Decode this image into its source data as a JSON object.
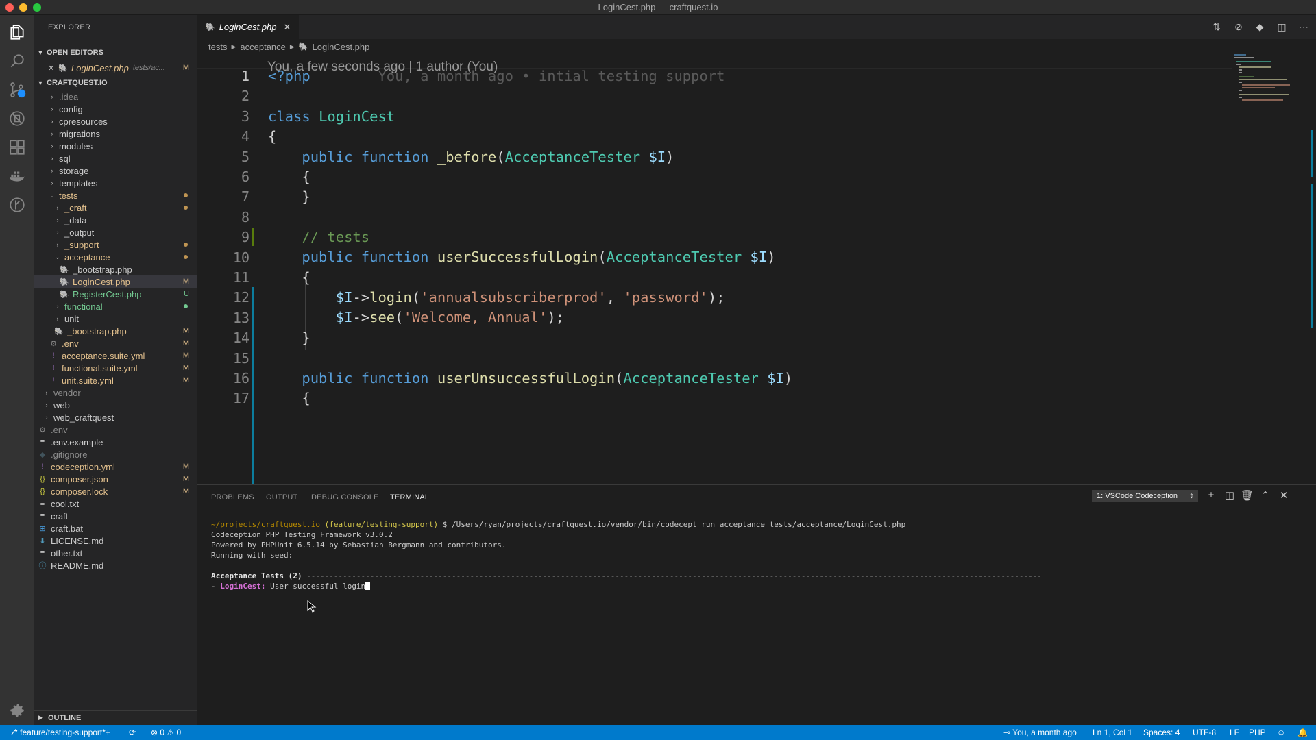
{
  "window": {
    "title": "LoginCest.php — craftquest.io"
  },
  "sidebar": {
    "title": "EXPLORER",
    "open_editors_label": "OPEN EDITORS",
    "open_editor": {
      "name": "LoginCest.php",
      "path": "tests/ac...",
      "status": "M",
      "close": "✕"
    },
    "project_label": "CRAFTQUEST.IO",
    "tree": [
      {
        "label": ".idea",
        "chev": "›"
      },
      {
        "label": "config",
        "chev": "›"
      },
      {
        "label": "cpresources",
        "chev": "›"
      },
      {
        "label": "migrations",
        "chev": "›"
      },
      {
        "label": "modules",
        "chev": "›"
      },
      {
        "label": "sql",
        "chev": "›"
      },
      {
        "label": "storage",
        "chev": "›"
      },
      {
        "label": "templates",
        "chev": "›"
      },
      {
        "label": "tests",
        "chev": "⌄"
      },
      {
        "label": "_craft",
        "chev": "›"
      },
      {
        "label": "_data",
        "chev": "›"
      },
      {
        "label": "_output",
        "chev": "›"
      },
      {
        "label": "_support",
        "chev": "›"
      },
      {
        "label": "acceptance",
        "chev": "⌄"
      },
      {
        "label": "_bootstrap.php",
        "icon": "🐘"
      },
      {
        "label": "LoginCest.php",
        "icon": "🐘",
        "status": "M"
      },
      {
        "label": "RegisterCest.php",
        "icon": "🐘",
        "status": "U"
      },
      {
        "label": "functional",
        "chev": "›"
      },
      {
        "label": "unit",
        "chev": "›"
      },
      {
        "label": "_bootstrap.php",
        "icon": "🐘",
        "status": "M"
      },
      {
        "label": ".env",
        "icon": "⚙",
        "status": "M"
      },
      {
        "label": "acceptance.suite.yml",
        "icon": "!",
        "status": "M"
      },
      {
        "label": "functional.suite.yml",
        "icon": "!",
        "status": "M"
      },
      {
        "label": "unit.suite.yml",
        "icon": "!",
        "status": "M"
      },
      {
        "label": "vendor",
        "chev": "›"
      },
      {
        "label": "web",
        "chev": "›"
      },
      {
        "label": "web_craftquest",
        "chev": "›"
      },
      {
        "label": ".env",
        "icon": "⚙"
      },
      {
        "label": ".env.example",
        "icon": "≡"
      },
      {
        "label": ".gitignore",
        "icon": "◆"
      },
      {
        "label": "codeception.yml",
        "icon": "!",
        "status": "M"
      },
      {
        "label": "composer.json",
        "icon": "{}",
        "status": "M"
      },
      {
        "label": "composer.lock",
        "icon": "{}",
        "status": "M"
      },
      {
        "label": "cool.txt",
        "icon": "≡"
      },
      {
        "label": "craft",
        "icon": "≡"
      },
      {
        "label": "craft.bat",
        "icon": "⊞"
      },
      {
        "label": "LICENSE.md",
        "icon": "⬇"
      },
      {
        "label": "other.txt",
        "icon": "≡"
      },
      {
        "label": "README.md",
        "icon": "ⓘ"
      }
    ],
    "outline_label": "OUTLINE"
  },
  "editor": {
    "tab": {
      "label": "LoginCest.php",
      "close": "✕"
    },
    "breadcrumb": [
      "tests",
      "acceptance",
      "LoginCest.php"
    ],
    "blame_header": "You, a few seconds ago | 1 author (You)",
    "line_numbers": [
      "1",
      "2",
      "3",
      "4",
      "5",
      "6",
      "7",
      "8",
      "9",
      "10",
      "11",
      "12",
      "13",
      "14",
      "15",
      "16",
      "17"
    ],
    "lines": {
      "l1_tag": "<?php",
      "l1_blame": "You, a month ago • intial testing support",
      "l3_kw": "class",
      "l3_cls": "LoginCest",
      "l4": "{",
      "l5_kw1": "public",
      "l5_kw2": "function",
      "l5_fn": "_before",
      "l5_open": "(",
      "l5_type": "AcceptanceTester",
      "l5_var": "$I",
      "l5_close": ")",
      "l6": "{",
      "l7": "}",
      "l9_cmt": "// tests",
      "l10_kw1": "public",
      "l10_kw2": "function",
      "l10_fn": "userSuccessfulLogin",
      "l10_open": "(",
      "l10_type": "AcceptanceTester",
      "l10_var": "$I",
      "l10_close": ")",
      "l11": "{",
      "l12_var": "$I",
      "l12_arrow": "->",
      "l12_fn": "login",
      "l12_open": "(",
      "l12_s1": "'annualsubscriberprod'",
      "l12_comma": ", ",
      "l12_s2": "'password'",
      "l12_close": ");",
      "l13_var": "$I",
      "l13_arrow": "->",
      "l13_fn": "see",
      "l13_open": "(",
      "l13_s1": "'Welcome, Annual'",
      "l13_close": ");",
      "l14": "}",
      "l16_kw1": "public",
      "l16_kw2": "function",
      "l16_fn": "userUnsuccessfulLogin",
      "l16_open": "(",
      "l16_type": "AcceptanceTester",
      "l16_var": "$I",
      "l16_close": ")",
      "l17": "{"
    }
  },
  "panel": {
    "tabs": [
      "PROBLEMS",
      "OUTPUT",
      "DEBUG CONSOLE",
      "TERMINAL"
    ],
    "terminal_select": "1: VSCode Codeception",
    "terminal": {
      "prompt_path": "~/projects/craftquest.io",
      "prompt_branch": "(feature/testing-support)",
      "command": " $ /Users/ryan/projects/craftquest.io/vendor/bin/codecept run acceptance tests/acceptance/LoginCest.php",
      "line2": "Codeception PHP Testing Framework v3.0.2",
      "line3": "Powered by PHPUnit 6.5.14 by Sebastian Bergmann and contributors.",
      "line4": "Running with seed:",
      "suite_heading": "Acceptance Tests (2)",
      "suite_rule": " ------------------------------------------------------------------------------------------------------------------------------------------------------------------",
      "test_prefix": "- ",
      "test_class": "LoginCest:",
      "test_name": " User successful login"
    }
  },
  "statusbar": {
    "branch": "feature/testing-support*+",
    "sync": "⟳",
    "errors": "0",
    "warnings": "0",
    "blame": "You, a month ago",
    "position": "Ln 1, Col 1",
    "spaces": "Spaces: 4",
    "encoding": "UTF-8",
    "eol": "LF",
    "language": "PHP"
  },
  "colors": {
    "accent": "#007acc",
    "modified": "#e2c08d",
    "untracked": "#73c991"
  }
}
